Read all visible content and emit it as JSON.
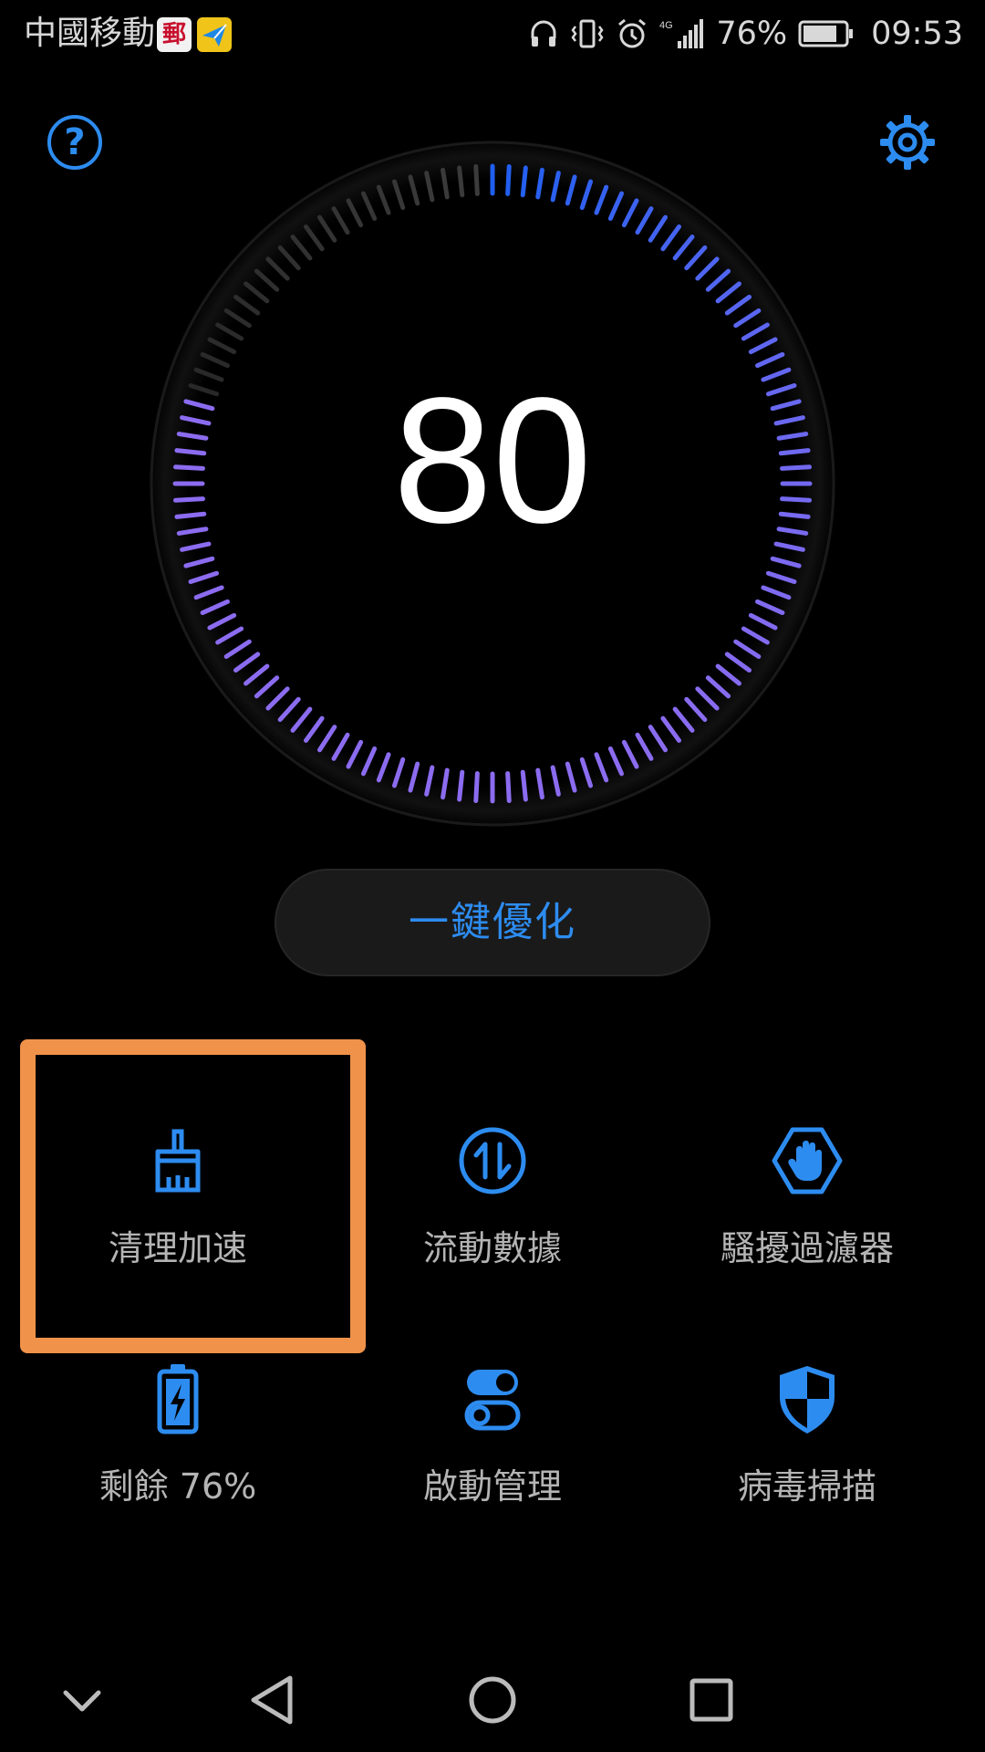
{
  "status_bar": {
    "carrier": "中國移動",
    "mail_icon_glyph": "郵",
    "network_label": "4G",
    "battery_percent": "76%",
    "time": "09:53"
  },
  "icons": {
    "help": "help-icon",
    "settings": "gear-icon"
  },
  "gauge": {
    "score": "80",
    "score_value": 80,
    "active_color_start": "#1f5ff0",
    "active_color_end": "#7b6cf5",
    "inactive_color": "#3a3a3a"
  },
  "optimize_button": {
    "label": "一鍵優化"
  },
  "tools": [
    {
      "label": "清理加速",
      "icon": "broom-icon"
    },
    {
      "label": "流動數據",
      "icon": "data-transfer-icon"
    },
    {
      "label": "騷擾過濾器",
      "icon": "hand-block-icon"
    },
    {
      "label": "剩餘 76%",
      "icon": "battery-bolt-icon"
    },
    {
      "label": "啟動管理",
      "icon": "toggle-switch-icon"
    },
    {
      "label": "病毒掃描",
      "icon": "shield-icon"
    }
  ],
  "accent_color": "#2d8cf0",
  "highlight_color": "#f0924a",
  "nav": [
    "chevron-down-icon",
    "back-triangle-icon",
    "home-circle-icon",
    "recents-square-icon"
  ]
}
